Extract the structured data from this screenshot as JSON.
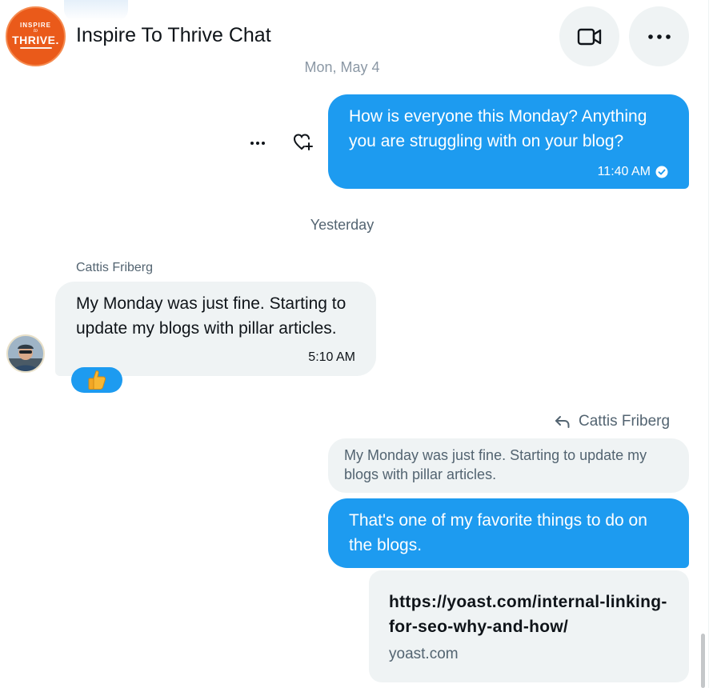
{
  "chat": {
    "title": "Inspire To Thrive Chat",
    "logo": {
      "line1": "INSPIRE",
      "line2": "to",
      "line3": "THRIVE."
    },
    "header_actions": [
      {
        "icon": "video-icon",
        "label": "Video call"
      },
      {
        "icon": "more-icon",
        "label": "More"
      }
    ]
  },
  "separators": {
    "first": "Mon, May 4",
    "second": "Yesterday"
  },
  "messages": {
    "m1": {
      "direction": "outgoing",
      "text": "How is everyone this Monday? Anything you are struggling with on your blog?",
      "time": "11:40 AM",
      "status": "seen"
    },
    "m2": {
      "direction": "incoming",
      "sender": "Cattis Friberg",
      "text": "My Monday was just fine. Starting to update my blogs with pillar articles.",
      "time": "5:10 AM",
      "reaction": "👍"
    },
    "m3": {
      "direction": "outgoing",
      "reply_to": "Cattis Friberg",
      "quote": "My Monday was just fine. Starting to update my blogs with pillar articles.",
      "text": "That's one of my favorite things to do on the blogs."
    },
    "m4": {
      "link_url": "https://yoast.com/internal-linking-for-seo-why-and-how/",
      "link_domain": "yoast.com"
    }
  },
  "colors": {
    "accent": "#1d9bf0",
    "bubble_in": "#eff3f4",
    "secondary_text": "#536471",
    "logo_orange": "#ea5a1a"
  }
}
